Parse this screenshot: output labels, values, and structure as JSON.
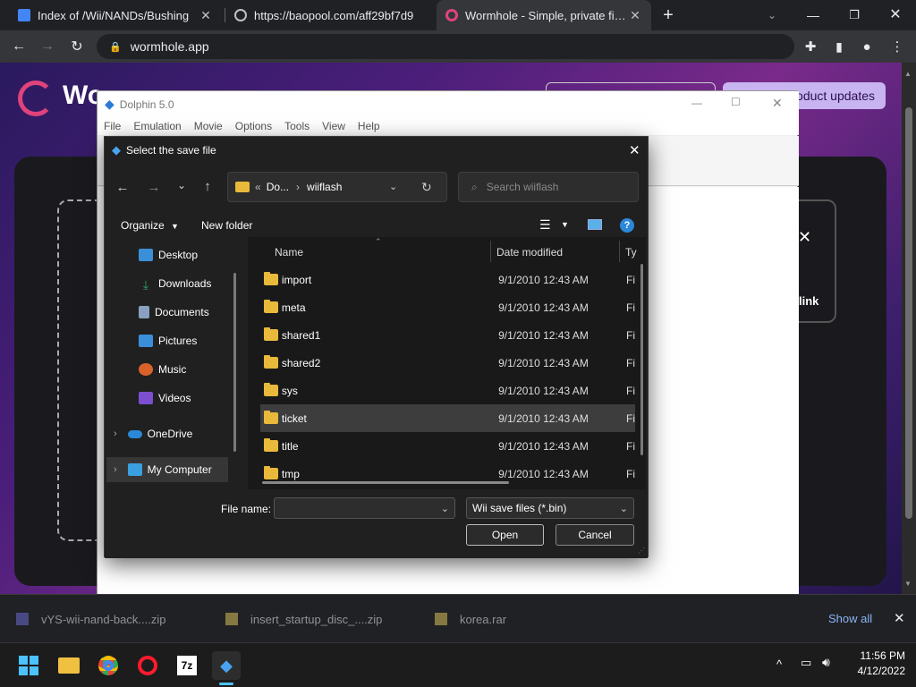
{
  "browser": {
    "tabs": [
      {
        "title": "Index of /Wii/NANDs/Bushing",
        "icon": "doc-icon"
      },
      {
        "title": "https://baopool.com/aff29bf7d9",
        "icon": "globe-icon"
      },
      {
        "title": "Wormhole - Simple, private file s",
        "icon": "wormhole-icon"
      }
    ],
    "url": "wormhole.app"
  },
  "web": {
    "logo_text": "Wo",
    "product_updates": "oduct updates",
    "link_label": "link"
  },
  "dolphin": {
    "title": "Dolphin 5.0",
    "menu": [
      "File",
      "Emulation",
      "Movie",
      "Options",
      "Tools",
      "View",
      "Help"
    ]
  },
  "dialog": {
    "title": "Select the save file",
    "breadcrumb": {
      "part1": "Do...",
      "part2": "wiiflash"
    },
    "search_placeholder": "Search wiiflash",
    "organize": "Organize",
    "new_folder": "New folder",
    "nav": [
      {
        "label": "Desktop",
        "icon": "desktop-icon",
        "color": "#3a8fd8",
        "pinned": true
      },
      {
        "label": "Downloads",
        "icon": "download-icon",
        "color": "#2ea36b",
        "pinned": true
      },
      {
        "label": "Documents",
        "icon": "document-icon",
        "color": "#8aa0c0",
        "pinned": true
      },
      {
        "label": "Pictures",
        "icon": "pictures-icon",
        "color": "#3a8fd8",
        "pinned": true
      },
      {
        "label": "Music",
        "icon": "music-icon",
        "color": "#d9622b",
        "pinned": false
      },
      {
        "label": "Videos",
        "icon": "videos-icon",
        "color": "#7b4fd0",
        "pinned": false
      },
      {
        "label": "OneDrive",
        "icon": "onedrive-icon",
        "color": "#2b88d8",
        "pinned": false
      },
      {
        "label": "My Computer",
        "icon": "computer-icon",
        "color": "#3aa0e0",
        "pinned": false
      }
    ],
    "columns": {
      "name": "Name",
      "date": "Date modified",
      "type": "Ty"
    },
    "files": [
      {
        "name": "import",
        "date": "9/1/2010 12:43 AM",
        "type": "Fi"
      },
      {
        "name": "meta",
        "date": "9/1/2010 12:43 AM",
        "type": "Fi"
      },
      {
        "name": "shared1",
        "date": "9/1/2010 12:43 AM",
        "type": "Fi"
      },
      {
        "name": "shared2",
        "date": "9/1/2010 12:43 AM",
        "type": "Fi"
      },
      {
        "name": "sys",
        "date": "9/1/2010 12:43 AM",
        "type": "Fi"
      },
      {
        "name": "ticket",
        "date": "9/1/2010 12:43 AM",
        "type": "Fi",
        "selected": true
      },
      {
        "name": "title",
        "date": "9/1/2010 12:43 AM",
        "type": "Fi"
      },
      {
        "name": "tmp",
        "date": "9/1/2010 12:43 AM",
        "type": "Fi"
      }
    ],
    "file_name_label": "File name:",
    "file_name_value": "",
    "filter": "Wii save files (*.bin)",
    "open": "Open",
    "cancel": "Cancel"
  },
  "downloads": {
    "items": [
      "vYS-wii-nand-back....zip",
      "insert_startup_disc_....zip",
      "korea.rar"
    ],
    "show_all": "Show all"
  },
  "taskbar": {
    "time": "11:56 PM",
    "date": "4/12/2022"
  }
}
